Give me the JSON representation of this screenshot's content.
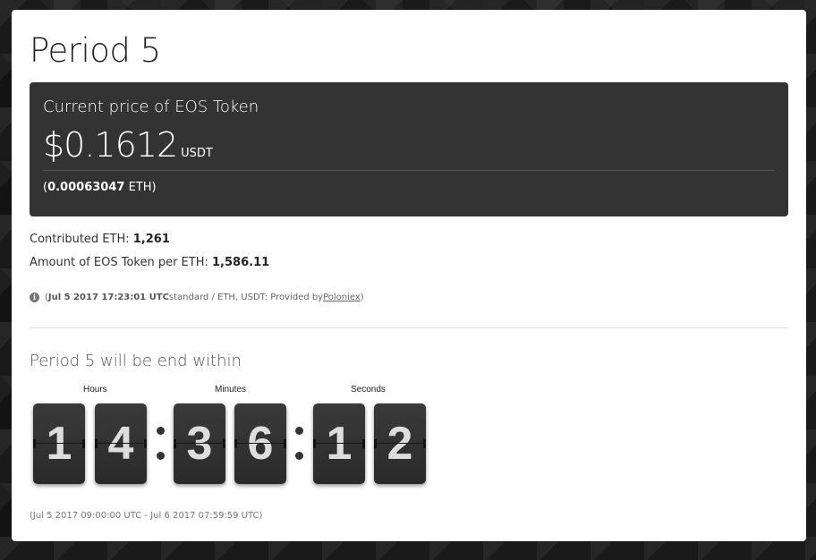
{
  "period_title": "Period 5",
  "price": {
    "label": "Current price of EOS Token",
    "value": "$0.1612",
    "unit": "USDT",
    "eth_prefix": "(",
    "eth_value": "0.00063047",
    "eth_suffix": " ETH)"
  },
  "stats": {
    "contributed_label": "Contributed ETH: ",
    "contributed_value": "1,261",
    "amount_label": "Amount of EOS Token per ETH: ",
    "amount_value": "1,586.11"
  },
  "info": {
    "icon": "info-icon",
    "open": "(",
    "timestamp": "Jul 5 2017 17:23:01 UTC",
    "middle": " standard / ETH, USDT: Provided by ",
    "provider_link": "Poloniex",
    "close": ")"
  },
  "countdown": {
    "title": "Period 5 will be end within",
    "hours_label": "Hours",
    "minutes_label": "Minutes",
    "seconds_label": "Seconds",
    "digits": [
      "1",
      "4",
      "3",
      "6",
      "1",
      "2"
    ]
  },
  "range_text": "(Jul 5 2017 09:00:00 UTC - Jul 6 2017 07:59:59 UTC)",
  "colors": {
    "dark_panel": "#333333",
    "card_bg": "#ffffff"
  }
}
